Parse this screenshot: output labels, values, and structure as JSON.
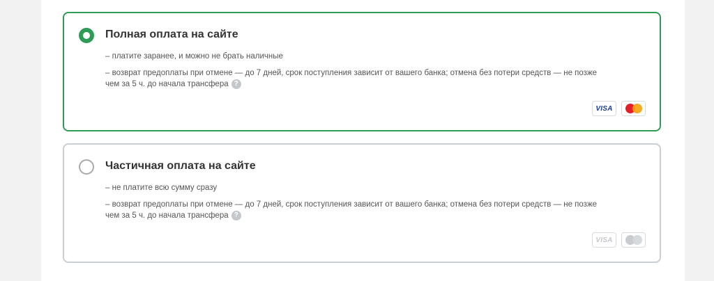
{
  "options": [
    {
      "title": "Полная оплата на сайте",
      "line1": "– платите заранее, и можно не брать наличные",
      "line2": "– возврат предоплаты при отмене — до 7 дней, срок поступления зависит от вашего банка; отмена без потери средств — не позже чем за 5 ч. до начала трансфера",
      "help": "?",
      "selected": true,
      "cards": {
        "visa": "VISA",
        "mastercard": "mastercard-icon"
      }
    },
    {
      "title": "Частичная оплата на сайте",
      "line1": "– не платите всю сумму сразу",
      "line2": "– возврат предоплаты при отмене — до 7 дней, срок поступления зависит от вашего банка; отмена без потери средств — не позже чем за 5 ч. до начала трансфера",
      "help": "?",
      "selected": false,
      "cards": {
        "visa": "VISA",
        "mastercard": "mastercard-icon"
      }
    }
  ],
  "colors": {
    "accent": "#2e9b57",
    "border_inactive": "#c9ced3"
  }
}
